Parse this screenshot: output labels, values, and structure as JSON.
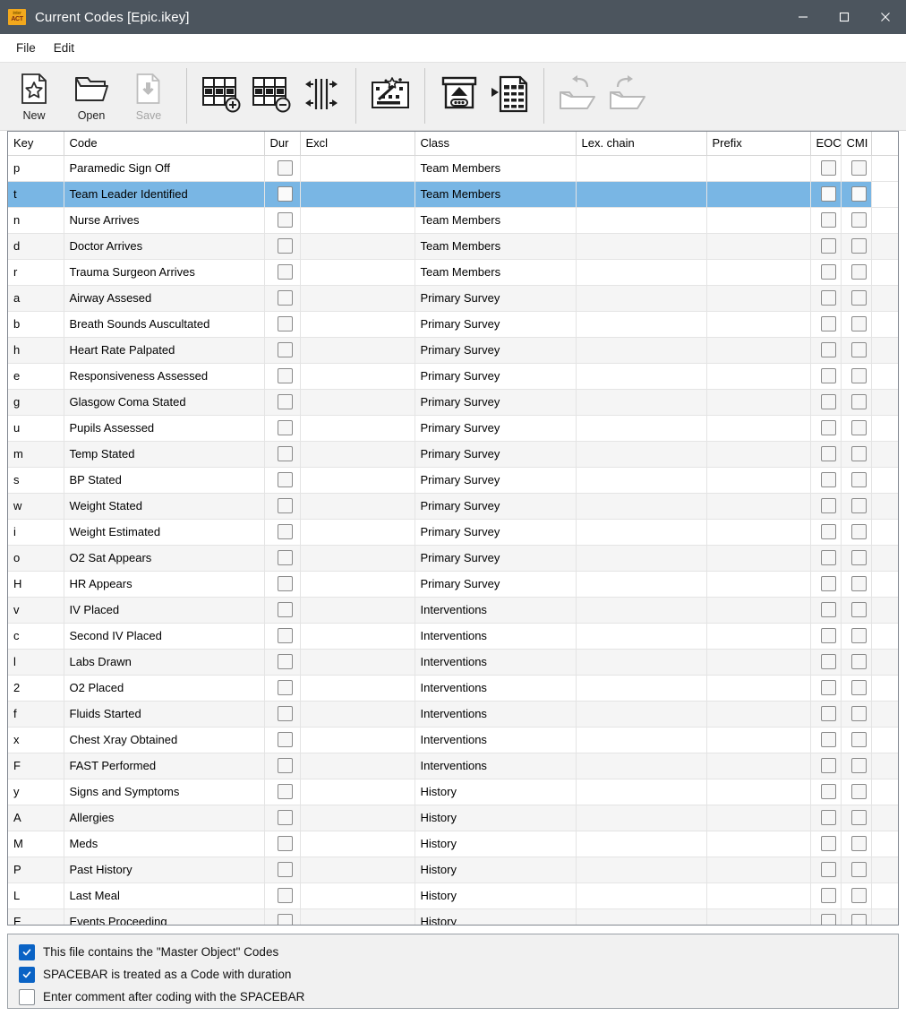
{
  "window": {
    "title": "Current Codes [Epic.ikey]",
    "app_icon": {
      "line1": "inter",
      "line2": "ACT",
      "color": "#f2a81d"
    },
    "titlebar_color": "#4c555e",
    "controls": {
      "minimize": "minimize-button",
      "maximize": "maximize-button",
      "close": "close-button"
    }
  },
  "menu": {
    "items": [
      {
        "label": "File"
      },
      {
        "label": "Edit"
      }
    ]
  },
  "toolbar": {
    "buttons": [
      {
        "label": "New",
        "icon": "new-file-icon",
        "enabled": true
      },
      {
        "label": "Open",
        "icon": "open-folder-icon",
        "enabled": true
      },
      {
        "label": "Save",
        "icon": "save-icon",
        "enabled": false
      }
    ],
    "icon_buttons": [
      {
        "icon": "add-row-icon",
        "enabled": true
      },
      {
        "icon": "remove-row-icon",
        "enabled": true
      },
      {
        "icon": "fit-columns-icon",
        "enabled": true
      },
      {
        "icon": "magic-wand-icon",
        "enabled": true
      },
      {
        "icon": "import-icon",
        "enabled": true
      },
      {
        "icon": "export-spreadsheet-icon",
        "enabled": true
      },
      {
        "icon": "undo-icon",
        "enabled": false
      },
      {
        "icon": "redo-icon",
        "enabled": false
      }
    ]
  },
  "table": {
    "columns": [
      {
        "key": "key",
        "label": "Key"
      },
      {
        "key": "code",
        "label": "Code"
      },
      {
        "key": "dur",
        "label": "Dur"
      },
      {
        "key": "excl",
        "label": "Excl"
      },
      {
        "key": "class",
        "label": "Class"
      },
      {
        "key": "lex",
        "label": "Lex. chain"
      },
      {
        "key": "prefix",
        "label": "Prefix"
      },
      {
        "key": "eoc",
        "label": "EOC"
      },
      {
        "key": "cmi",
        "label": "CMI"
      },
      {
        "key": "filler",
        "label": ""
      }
    ],
    "selected_row_index": 1,
    "selection_color": "#79b6e4",
    "rows": [
      {
        "key": "p",
        "code": "Paramedic Sign Off",
        "dur": false,
        "excl": "",
        "class": "Team Members",
        "lex": "",
        "prefix": "",
        "eoc": false,
        "cmi": false
      },
      {
        "key": "t",
        "code": "Team Leader Identified",
        "dur": false,
        "excl": "",
        "class": "Team Members",
        "lex": "",
        "prefix": "",
        "eoc": false,
        "cmi": false
      },
      {
        "key": "n",
        "code": "Nurse Arrives",
        "dur": false,
        "excl": "",
        "class": "Team Members",
        "lex": "",
        "prefix": "",
        "eoc": false,
        "cmi": false
      },
      {
        "key": "d",
        "code": "Doctor Arrives",
        "dur": false,
        "excl": "",
        "class": "Team Members",
        "lex": "",
        "prefix": "",
        "eoc": false,
        "cmi": false
      },
      {
        "key": "r",
        "code": "Trauma Surgeon Arrives",
        "dur": false,
        "excl": "",
        "class": "Team Members",
        "lex": "",
        "prefix": "",
        "eoc": false,
        "cmi": false
      },
      {
        "key": "a",
        "code": "Airway Assesed",
        "dur": false,
        "excl": "",
        "class": "Primary Survey",
        "lex": "",
        "prefix": "",
        "eoc": false,
        "cmi": false
      },
      {
        "key": "b",
        "code": "Breath Sounds Auscultated",
        "dur": false,
        "excl": "",
        "class": "Primary Survey",
        "lex": "",
        "prefix": "",
        "eoc": false,
        "cmi": false
      },
      {
        "key": "h",
        "code": "Heart Rate Palpated",
        "dur": false,
        "excl": "",
        "class": "Primary Survey",
        "lex": "",
        "prefix": "",
        "eoc": false,
        "cmi": false
      },
      {
        "key": "e",
        "code": "Responsiveness Assessed",
        "dur": false,
        "excl": "",
        "class": "Primary Survey",
        "lex": "",
        "prefix": "",
        "eoc": false,
        "cmi": false
      },
      {
        "key": "g",
        "code": "Glasgow Coma Stated",
        "dur": false,
        "excl": "",
        "class": "Primary Survey",
        "lex": "",
        "prefix": "",
        "eoc": false,
        "cmi": false
      },
      {
        "key": "u",
        "code": "Pupils Assessed",
        "dur": false,
        "excl": "",
        "class": "Primary Survey",
        "lex": "",
        "prefix": "",
        "eoc": false,
        "cmi": false
      },
      {
        "key": "m",
        "code": "Temp Stated",
        "dur": false,
        "excl": "",
        "class": "Primary Survey",
        "lex": "",
        "prefix": "",
        "eoc": false,
        "cmi": false
      },
      {
        "key": "s",
        "code": "BP Stated",
        "dur": false,
        "excl": "",
        "class": "Primary Survey",
        "lex": "",
        "prefix": "",
        "eoc": false,
        "cmi": false
      },
      {
        "key": "w",
        "code": "Weight Stated",
        "dur": false,
        "excl": "",
        "class": "Primary Survey",
        "lex": "",
        "prefix": "",
        "eoc": false,
        "cmi": false
      },
      {
        "key": "i",
        "code": "Weight Estimated",
        "dur": false,
        "excl": "",
        "class": "Primary Survey",
        "lex": "",
        "prefix": "",
        "eoc": false,
        "cmi": false
      },
      {
        "key": "o",
        "code": "O2 Sat Appears",
        "dur": false,
        "excl": "",
        "class": "Primary Survey",
        "lex": "",
        "prefix": "",
        "eoc": false,
        "cmi": false
      },
      {
        "key": "H",
        "code": "HR Appears",
        "dur": false,
        "excl": "",
        "class": "Primary Survey",
        "lex": "",
        "prefix": "",
        "eoc": false,
        "cmi": false
      },
      {
        "key": "v",
        "code": "IV Placed",
        "dur": false,
        "excl": "",
        "class": "Interventions",
        "lex": "",
        "prefix": "",
        "eoc": false,
        "cmi": false
      },
      {
        "key": "c",
        "code": "Second IV Placed",
        "dur": false,
        "excl": "",
        "class": "Interventions",
        "lex": "",
        "prefix": "",
        "eoc": false,
        "cmi": false
      },
      {
        "key": "l",
        "code": "Labs Drawn",
        "dur": false,
        "excl": "",
        "class": "Interventions",
        "lex": "",
        "prefix": "",
        "eoc": false,
        "cmi": false
      },
      {
        "key": "2",
        "code": "O2 Placed",
        "dur": false,
        "excl": "",
        "class": "Interventions",
        "lex": "",
        "prefix": "",
        "eoc": false,
        "cmi": false
      },
      {
        "key": "f",
        "code": "Fluids Started",
        "dur": false,
        "excl": "",
        "class": "Interventions",
        "lex": "",
        "prefix": "",
        "eoc": false,
        "cmi": false
      },
      {
        "key": "x",
        "code": "Chest Xray Obtained",
        "dur": false,
        "excl": "",
        "class": "Interventions",
        "lex": "",
        "prefix": "",
        "eoc": false,
        "cmi": false
      },
      {
        "key": "F",
        "code": "FAST Performed",
        "dur": false,
        "excl": "",
        "class": "Interventions",
        "lex": "",
        "prefix": "",
        "eoc": false,
        "cmi": false
      },
      {
        "key": "y",
        "code": "Signs and Symptoms",
        "dur": false,
        "excl": "",
        "class": "History",
        "lex": "",
        "prefix": "",
        "eoc": false,
        "cmi": false
      },
      {
        "key": "A",
        "code": "Allergies",
        "dur": false,
        "excl": "",
        "class": "History",
        "lex": "",
        "prefix": "",
        "eoc": false,
        "cmi": false
      },
      {
        "key": "M",
        "code": "Meds",
        "dur": false,
        "excl": "",
        "class": "History",
        "lex": "",
        "prefix": "",
        "eoc": false,
        "cmi": false
      },
      {
        "key": "P",
        "code": "Past History",
        "dur": false,
        "excl": "",
        "class": "History",
        "lex": "",
        "prefix": "",
        "eoc": false,
        "cmi": false
      },
      {
        "key": "L",
        "code": "Last Meal",
        "dur": false,
        "excl": "",
        "class": "History",
        "lex": "",
        "prefix": "",
        "eoc": false,
        "cmi": false
      },
      {
        "key": "E",
        "code": "Events Proceeding",
        "dur": false,
        "excl": "",
        "class": "History",
        "lex": "",
        "prefix": "",
        "eoc": false,
        "cmi": false
      }
    ]
  },
  "options": {
    "accent_color": "#0a63c5",
    "items": [
      {
        "label": "This file contains the \"Master Object\" Codes",
        "checked": true
      },
      {
        "label": "SPACEBAR is treated as a Code with duration",
        "checked": true
      },
      {
        "label": "Enter comment after coding with the SPACEBAR",
        "checked": false
      }
    ]
  }
}
